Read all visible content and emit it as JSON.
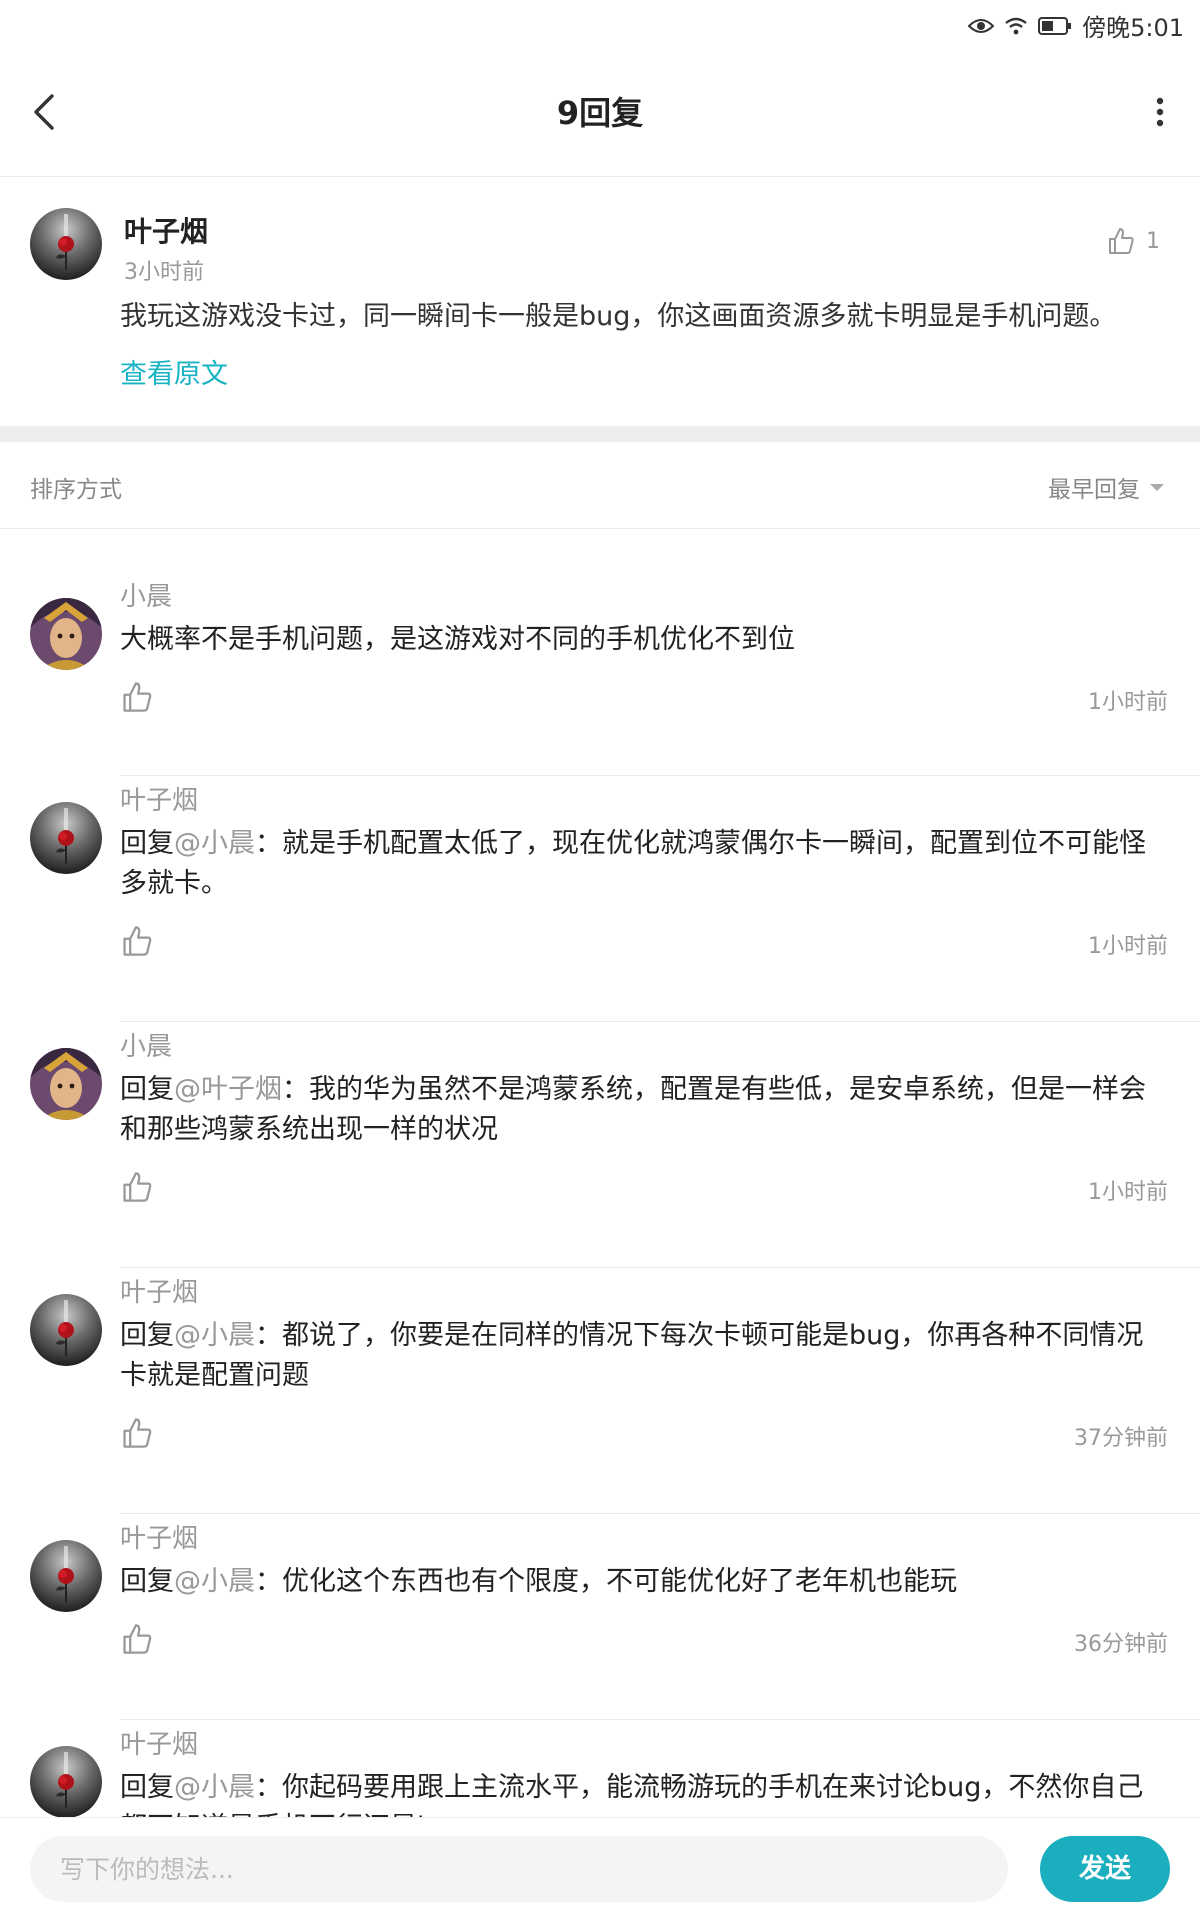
{
  "status_bar": {
    "time": "傍晚5:01"
  },
  "header": {
    "title": "9回复"
  },
  "original_post": {
    "author": "叶子烟",
    "time": "3小时前",
    "content": "我玩这游戏没卡过，同一瞬间卡一般是bug，你这画面资源多就卡明显是手机问题。",
    "view_original": "查看原文",
    "like_count": "1"
  },
  "sort": {
    "label": "排序方式",
    "selected": "最早回复"
  },
  "replies": [
    {
      "author": "小晨",
      "prefix": "",
      "mention": "",
      "text": "大概率不是手机问题，是这游戏对不同的手机优化不到位",
      "time": "1小时前"
    },
    {
      "author": "叶子烟",
      "prefix": "回复",
      "mention": "@小晨",
      "text": "：就是手机配置太低了，现在优化就鸿蒙偶尔卡一瞬间，配置到位不可能怪多就卡。",
      "time": "1小时前"
    },
    {
      "author": "小晨",
      "prefix": "回复",
      "mention": "@叶子烟",
      "text": "：我的华为虽然不是鸿蒙系统，配置是有些低，是安卓系统，但是一样会和那些鸿蒙系统出现一样的状况",
      "time": "1小时前"
    },
    {
      "author": "叶子烟",
      "prefix": "回复",
      "mention": "@小晨",
      "text": "：都说了，你要是在同样的情况下每次卡顿可能是bug，你再各种不同情况卡就是配置问题",
      "time": "37分钟前"
    },
    {
      "author": "叶子烟",
      "prefix": "回复",
      "mention": "@小晨",
      "text": "：优化这个东西也有个限度，不可能优化好了老年机也能玩",
      "time": "36分钟前"
    },
    {
      "author": "叶子烟",
      "prefix": "回复",
      "mention": "@小晨",
      "text": "：你起码要用跟上主流水平，能流畅游玩的手机在来讨论bug，不然你自己都不知道是手机不行还是bug",
      "time": ""
    }
  ],
  "composer": {
    "placeholder": "写下你的想法...",
    "send_label": "发送"
  },
  "colors": {
    "accent": "#1aaebe",
    "link": "#18b4c4"
  }
}
